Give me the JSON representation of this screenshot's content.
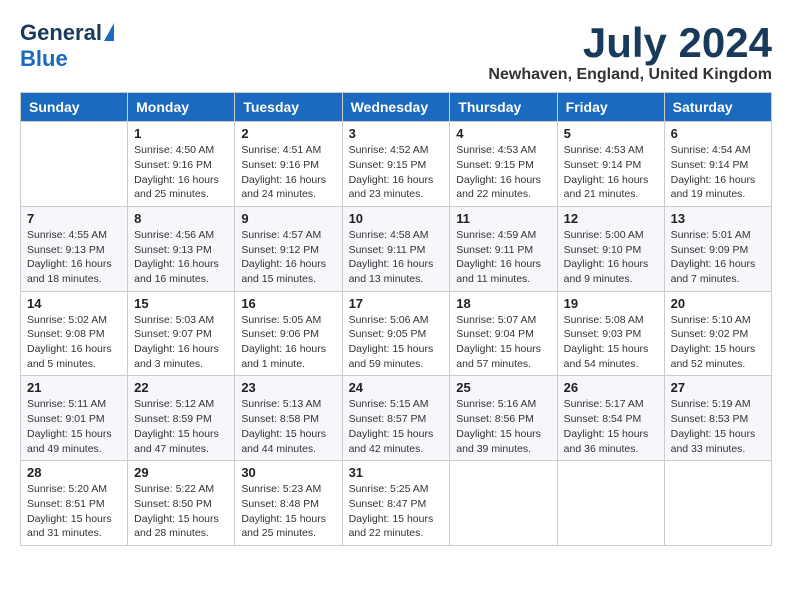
{
  "logo": {
    "general": "General",
    "blue": "Blue"
  },
  "header": {
    "month": "July 2024",
    "location": "Newhaven, England, United Kingdom"
  },
  "days_of_week": [
    "Sunday",
    "Monday",
    "Tuesday",
    "Wednesday",
    "Thursday",
    "Friday",
    "Saturday"
  ],
  "weeks": [
    [
      {
        "day": "",
        "info": ""
      },
      {
        "day": "1",
        "info": "Sunrise: 4:50 AM\nSunset: 9:16 PM\nDaylight: 16 hours\nand 25 minutes."
      },
      {
        "day": "2",
        "info": "Sunrise: 4:51 AM\nSunset: 9:16 PM\nDaylight: 16 hours\nand 24 minutes."
      },
      {
        "day": "3",
        "info": "Sunrise: 4:52 AM\nSunset: 9:15 PM\nDaylight: 16 hours\nand 23 minutes."
      },
      {
        "day": "4",
        "info": "Sunrise: 4:53 AM\nSunset: 9:15 PM\nDaylight: 16 hours\nand 22 minutes."
      },
      {
        "day": "5",
        "info": "Sunrise: 4:53 AM\nSunset: 9:14 PM\nDaylight: 16 hours\nand 21 minutes."
      },
      {
        "day": "6",
        "info": "Sunrise: 4:54 AM\nSunset: 9:14 PM\nDaylight: 16 hours\nand 19 minutes."
      }
    ],
    [
      {
        "day": "7",
        "info": "Sunrise: 4:55 AM\nSunset: 9:13 PM\nDaylight: 16 hours\nand 18 minutes."
      },
      {
        "day": "8",
        "info": "Sunrise: 4:56 AM\nSunset: 9:13 PM\nDaylight: 16 hours\nand 16 minutes."
      },
      {
        "day": "9",
        "info": "Sunrise: 4:57 AM\nSunset: 9:12 PM\nDaylight: 16 hours\nand 15 minutes."
      },
      {
        "day": "10",
        "info": "Sunrise: 4:58 AM\nSunset: 9:11 PM\nDaylight: 16 hours\nand 13 minutes."
      },
      {
        "day": "11",
        "info": "Sunrise: 4:59 AM\nSunset: 9:11 PM\nDaylight: 16 hours\nand 11 minutes."
      },
      {
        "day": "12",
        "info": "Sunrise: 5:00 AM\nSunset: 9:10 PM\nDaylight: 16 hours\nand 9 minutes."
      },
      {
        "day": "13",
        "info": "Sunrise: 5:01 AM\nSunset: 9:09 PM\nDaylight: 16 hours\nand 7 minutes."
      }
    ],
    [
      {
        "day": "14",
        "info": "Sunrise: 5:02 AM\nSunset: 9:08 PM\nDaylight: 16 hours\nand 5 minutes."
      },
      {
        "day": "15",
        "info": "Sunrise: 5:03 AM\nSunset: 9:07 PM\nDaylight: 16 hours\nand 3 minutes."
      },
      {
        "day": "16",
        "info": "Sunrise: 5:05 AM\nSunset: 9:06 PM\nDaylight: 16 hours\nand 1 minute."
      },
      {
        "day": "17",
        "info": "Sunrise: 5:06 AM\nSunset: 9:05 PM\nDaylight: 15 hours\nand 59 minutes."
      },
      {
        "day": "18",
        "info": "Sunrise: 5:07 AM\nSunset: 9:04 PM\nDaylight: 15 hours\nand 57 minutes."
      },
      {
        "day": "19",
        "info": "Sunrise: 5:08 AM\nSunset: 9:03 PM\nDaylight: 15 hours\nand 54 minutes."
      },
      {
        "day": "20",
        "info": "Sunrise: 5:10 AM\nSunset: 9:02 PM\nDaylight: 15 hours\nand 52 minutes."
      }
    ],
    [
      {
        "day": "21",
        "info": "Sunrise: 5:11 AM\nSunset: 9:01 PM\nDaylight: 15 hours\nand 49 minutes."
      },
      {
        "day": "22",
        "info": "Sunrise: 5:12 AM\nSunset: 8:59 PM\nDaylight: 15 hours\nand 47 minutes."
      },
      {
        "day": "23",
        "info": "Sunrise: 5:13 AM\nSunset: 8:58 PM\nDaylight: 15 hours\nand 44 minutes."
      },
      {
        "day": "24",
        "info": "Sunrise: 5:15 AM\nSunset: 8:57 PM\nDaylight: 15 hours\nand 42 minutes."
      },
      {
        "day": "25",
        "info": "Sunrise: 5:16 AM\nSunset: 8:56 PM\nDaylight: 15 hours\nand 39 minutes."
      },
      {
        "day": "26",
        "info": "Sunrise: 5:17 AM\nSunset: 8:54 PM\nDaylight: 15 hours\nand 36 minutes."
      },
      {
        "day": "27",
        "info": "Sunrise: 5:19 AM\nSunset: 8:53 PM\nDaylight: 15 hours\nand 33 minutes."
      }
    ],
    [
      {
        "day": "28",
        "info": "Sunrise: 5:20 AM\nSunset: 8:51 PM\nDaylight: 15 hours\nand 31 minutes."
      },
      {
        "day": "29",
        "info": "Sunrise: 5:22 AM\nSunset: 8:50 PM\nDaylight: 15 hours\nand 28 minutes."
      },
      {
        "day": "30",
        "info": "Sunrise: 5:23 AM\nSunset: 8:48 PM\nDaylight: 15 hours\nand 25 minutes."
      },
      {
        "day": "31",
        "info": "Sunrise: 5:25 AM\nSunset: 8:47 PM\nDaylight: 15 hours\nand 22 minutes."
      },
      {
        "day": "",
        "info": ""
      },
      {
        "day": "",
        "info": ""
      },
      {
        "day": "",
        "info": ""
      }
    ]
  ]
}
